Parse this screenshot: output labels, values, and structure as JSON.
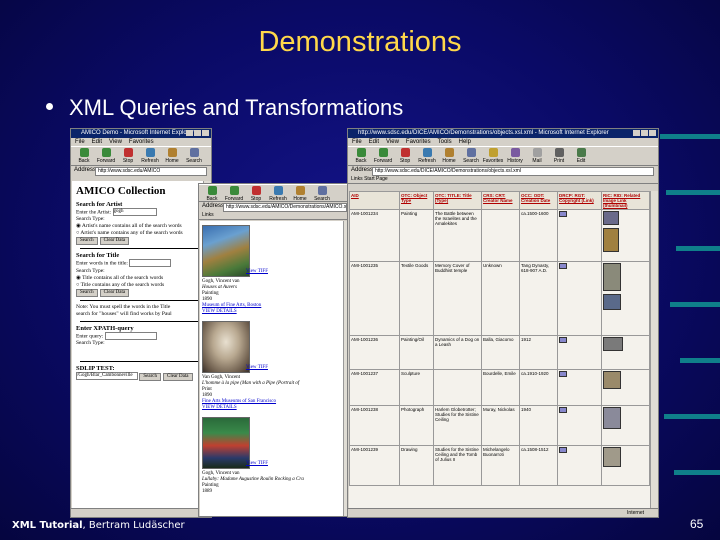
{
  "slide": {
    "title": "Demonstrations",
    "bullet": "XML Queries and Transformations",
    "footer_bold": "XML Tutorial",
    "footer_rest": ", Bertram Ludäscher",
    "page_number": "65"
  },
  "browser_common": {
    "menu": [
      "File",
      "Edit",
      "View",
      "Favorites",
      "Tools",
      "Help"
    ],
    "tools": [
      "Back",
      "Forward",
      "Stop",
      "Refresh",
      "Home",
      "Search",
      "Favorites",
      "History",
      "Mail",
      "Print",
      "Edit"
    ],
    "address_label": "Address",
    "links_label": "Links"
  },
  "window1": {
    "title": "AMICO Demo - Microsoft Internet Explorer",
    "address": "http://www.sdsc.edu/AMICO",
    "app_title": "AMICO Collection",
    "search_artist": {
      "heading": "Search for Artist",
      "label": "Enter the Artist:",
      "value": "gogh",
      "type_label": "Search Type:",
      "opt1": "Artist's name contains all of the search words",
      "opt2": "Artist's name contains any of the search words",
      "search_btn": "Search",
      "clear_btn": "Clear Data"
    },
    "search_title": {
      "heading": "Search for Title",
      "label": "Enter words in the title:",
      "type_label": "Search Type:",
      "opt1": "Title contains all of the search words",
      "opt2": "Title contains any of the search words",
      "search_btn": "Search",
      "clear_btn": "Clear Data"
    },
    "note": "Note: You must spell the words in the Title",
    "note2": "search for \"houses\" will find works by Paul",
    "xpath": {
      "heading": "Enter XPATH-query",
      "label": "Enter query:",
      "type_label": "Search Type:"
    },
    "sdlip": {
      "heading": "SDLIP TEST:",
      "value": "/Gogh/Blar_Cambonneville",
      "search_btn": "Search",
      "clear_btn": "Clear Data"
    }
  },
  "window2": {
    "address": "http://www.sdsc.edu/AMICO/Demonstrations/AMICO.xml",
    "links_label": "Links",
    "results": [
      {
        "view": "View TIFF",
        "artist": "Gogh, Vincent van",
        "title": "Houses at Auvers",
        "medium": "Painting",
        "year": "1890",
        "museum": "Museum of Fine Arts, Boston",
        "details": "VIEW DETAILS"
      },
      {
        "view": "View TIFF",
        "artist": "Van Gogh, Vincent",
        "title": "L'homme à la pipe (Man with a Pipe (Portrait of",
        "medium": "Print",
        "year": "1890",
        "museum": "Fine Arts Museums of San Francisco",
        "details": "VIEW DETAILS"
      },
      {
        "view": "View TIFF",
        "artist": "Gogh, Vincent van",
        "title": "Lullaby: Madame Augustine Roulin Rocking a Cra",
        "medium": "Painting",
        "year": "1889",
        "museum": "",
        "details": ""
      }
    ]
  },
  "window3": {
    "title": "http://www.sdsc.edu/DICE/AMICO/Demonstrations/objects.xsl.xml - Microsoft Internet Explorer",
    "address": "http://www.sdsc.edu/DICE/AMICO/Demonstrations/objects.xsl.xml",
    "tab": "Start Page",
    "status": "Internet",
    "headers": [
      "AID",
      "OTC: Object Type",
      "OTC: TITLE: Title (Type)",
      "CRS: CRT: Creator Name",
      "OCC: ODT: Creation Date",
      "DRCP: RGT: Copyright (Link)",
      "RIC: RID: Related Image Link (thumbnail)"
    ],
    "rows": [
      [
        "AMI-1001234",
        "Painting",
        "The Battle between the Israelites and the Amalekites",
        "",
        "ca.1500-1600",
        "",
        ""
      ],
      [
        "AMI-1001235",
        "Textile Goods",
        "Memory Cover of Buddhist temple",
        "Unknown",
        "Tang Dynasty, 618-907 A.D.",
        "",
        ""
      ],
      [
        "AMI-1001236",
        "Painting/Oil",
        "Dynamics of a Dog on a Leash",
        "Balla, Giacomo",
        "1912",
        "",
        ""
      ],
      [
        "AMI-1001237",
        "Sculpture",
        "",
        "Bourdelle, Emile",
        "ca.1910-1920",
        "",
        ""
      ],
      [
        "AMI-1001238",
        "Photograph",
        "Harlem Globetrotter; Studies for the Sistine Ceiling",
        "Muray, Nickolas",
        "1940",
        "",
        ""
      ],
      [
        "AMI-1001239",
        "Drawing",
        "Studies for the Sistine Ceiling and the Tomb of Julius II",
        "Michelangelo Buonarroti",
        "ca.1508-1512",
        "",
        ""
      ]
    ]
  },
  "colors": {
    "background": "#0a0a66",
    "title": "#ffd84a",
    "titlebar": "#0a246a",
    "deco": "#0f7f8a"
  }
}
